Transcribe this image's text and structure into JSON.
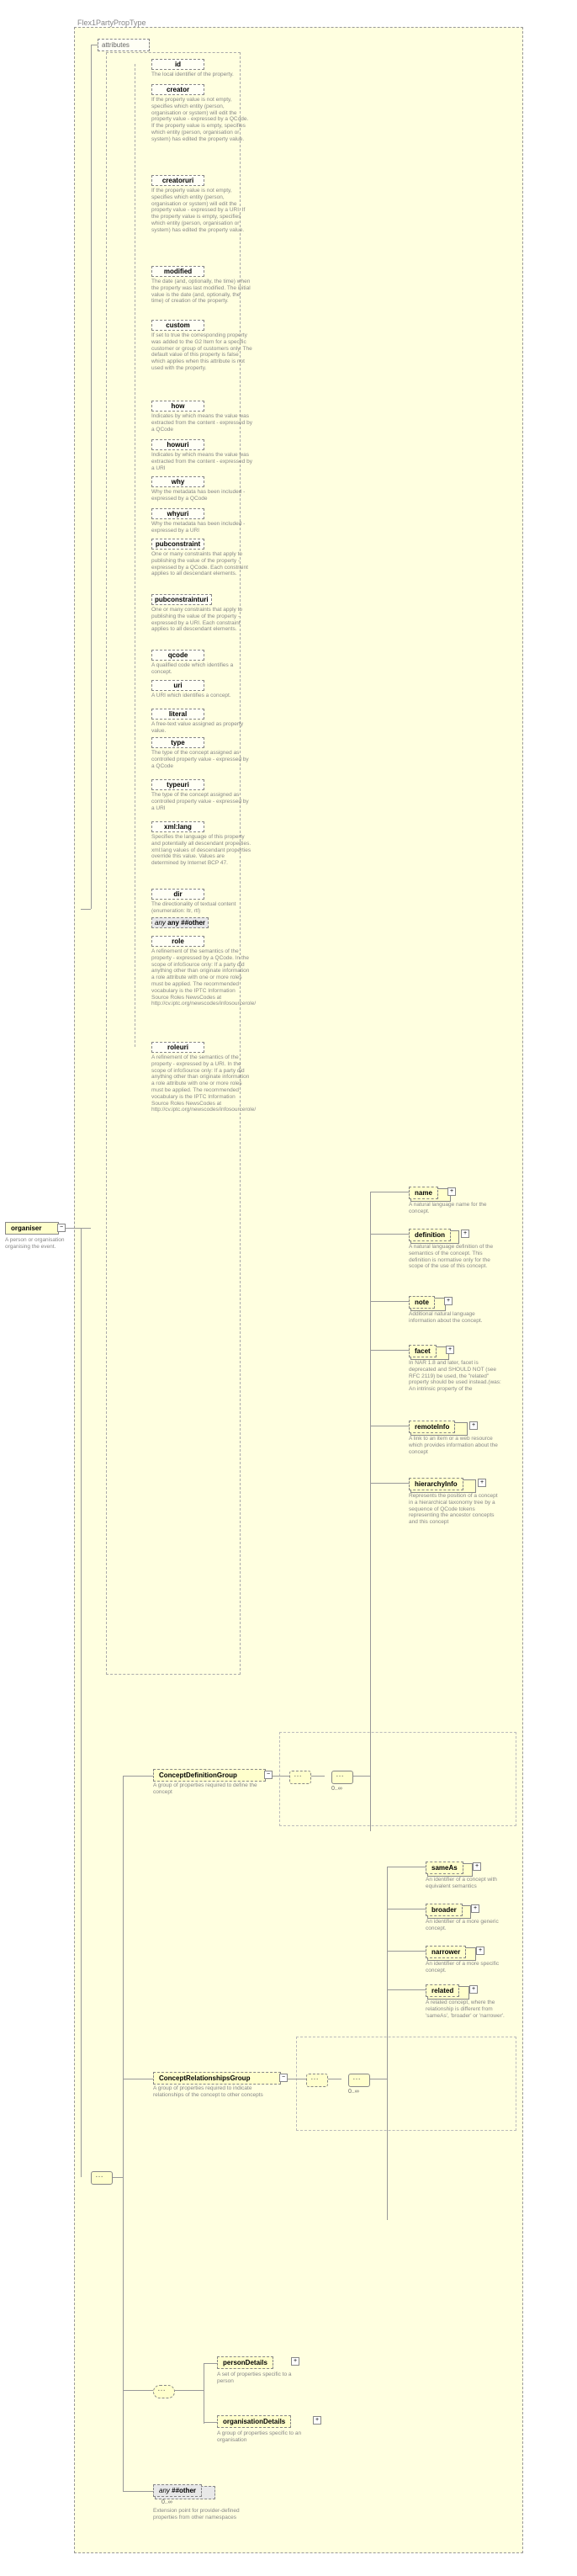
{
  "root": {
    "name": "organiser",
    "desc": "A person or organisation organising the event."
  },
  "type_name": "Flex1PartyPropType",
  "attributes_label": "attributes",
  "attributes": [
    {
      "name": "id",
      "desc": "The local identifier of the property."
    },
    {
      "name": "creator",
      "desc": "If the property value is not empty, specifies which entity (person, organisation or system) will edit the property value - expressed by a QCode. If the property value is empty, specifies which entity (person, organisation or system) has edited the property value."
    },
    {
      "name": "creatoruri",
      "desc": "If the property value is not empty, specifies which entity (person, organisation or system) will edit the property value - expressed by a URI. If the property value is empty, specifies which entity (person, organisation or system) has edited the property value."
    },
    {
      "name": "modified",
      "desc": "The date (and, optionally, the time) when the property was last modified. The initial value is the date (and, optionally, the time) of creation of the property."
    },
    {
      "name": "custom",
      "desc": "If set to true the corresponding property was added to the G2 Item for a specific customer or group of customers only. The default value of this property is false which applies when this attribute is not used with the property."
    },
    {
      "name": "how",
      "desc": "Indicates by which means the value was extracted from the content - expressed by a QCode"
    },
    {
      "name": "howuri",
      "desc": "Indicates by which means the value was extracted from the content - expressed by a URI"
    },
    {
      "name": "why",
      "desc": "Why the metadata has been included - expressed by a QCode"
    },
    {
      "name": "whyuri",
      "desc": "Why the metadata has been included - expressed by a URI"
    },
    {
      "name": "pubconstraint",
      "desc": "One or many constraints that apply to publishing the value of the property - expressed by a QCode. Each constraint applies to all descendant elements."
    },
    {
      "name": "pubconstrainturi",
      "desc": "One or many constraints that apply to publishing the value of the property - expressed by a URI. Each constraint applies to all descendant elements."
    },
    {
      "name": "qcode",
      "desc": "A qualified code which identifies a concept."
    },
    {
      "name": "uri",
      "desc": "A URI which identifies a concept."
    },
    {
      "name": "literal",
      "desc": "A free-text value assigned as property value."
    },
    {
      "name": "type",
      "desc": "The type of the concept assigned as controlled property value - expressed by a QCode"
    },
    {
      "name": "typeuri",
      "desc": "The type of the concept assigned as controlled property value - expressed by a URI"
    },
    {
      "name": "xml:lang",
      "desc": "Specifies the language of this property and potentially all descendant properties. xml:lang values of descendant properties override this value. Values are determined by Internet BCP 47."
    },
    {
      "name": "dir",
      "desc": "The directionality of textual content (enumeration: ltr, rtl)"
    },
    {
      "name": "any ##other",
      "desc": "",
      "special": true
    },
    {
      "name": "role",
      "desc": "A refinement of the semantics of the property - expressed by a QCode. In the scope of infoSource only: If a party did anything other than originate information a role attribute with one or more roles must be applied. The recommended vocabulary is the IPTC Information Source Roles NewsCodes at http://cv.iptc.org/newscodes/infosourcerole/"
    },
    {
      "name": "roleuri",
      "desc": "A refinement of the semantics of the property - expressed by a URI. In the scope of infoSource only: If a party did anything other than originate information a role attribute with one or more roles must be applied. The recommended vocabulary is the IPTC Information Source Roles NewsCodes at http://cv.iptc.org/newscodes/infosourcerole/"
    }
  ],
  "groups": {
    "def": {
      "name": "ConceptDefinitionGroup",
      "desc": "A group of properties required to define the concept",
      "items": [
        {
          "name": "name",
          "desc": "A natural language name for the concept."
        },
        {
          "name": "definition",
          "desc": "A natural language definition of the semantics of the concept. This definition is normative only for the scope of the use of this concept."
        },
        {
          "name": "note",
          "desc": "Additional natural language information about the concept."
        },
        {
          "name": "facet",
          "desc": "In NAR 1.8 and later, facet is deprecated and SHOULD NOT (see RFC 2119) be used, the \"related\" property should be used instead.(was: An intrinsic property of the"
        },
        {
          "name": "remoteInfo",
          "desc": "A link to an item or a web resource which provides information about the concept"
        },
        {
          "name": "hierarchyInfo",
          "desc": "Represents the position of a concept in a hierarchical taxonomy tree by a sequence of QCode tokens representing the ancestor concepts and this concept"
        }
      ]
    },
    "rel": {
      "name": "ConceptRelationshipsGroup",
      "desc": "A group of properties required to indicate relationships of the concept to other concepts",
      "items": [
        {
          "name": "sameAs",
          "desc": "An identifier of a concept with equivalent semantics"
        },
        {
          "name": "broader",
          "desc": "An identifier of a more generic concept."
        },
        {
          "name": "narrower",
          "desc": "An identifier of a more specific concept."
        },
        {
          "name": "related",
          "desc": "A related concept, where the relationship is different from 'sameAs', 'broader' or 'narrower'."
        }
      ]
    }
  },
  "details": {
    "person": {
      "name": "personDetails",
      "desc": "A set of properties specific to a person"
    },
    "org": {
      "name": "organisationDetails",
      "desc": "A group of properties specific to an organisation"
    }
  },
  "ext": {
    "name": "##other",
    "desc": "Extension point for provider-defined properties from other namespaces"
  },
  "glyph": {
    "any": "any",
    "card": "0..∞",
    "plus": "+",
    "minus": "−"
  }
}
